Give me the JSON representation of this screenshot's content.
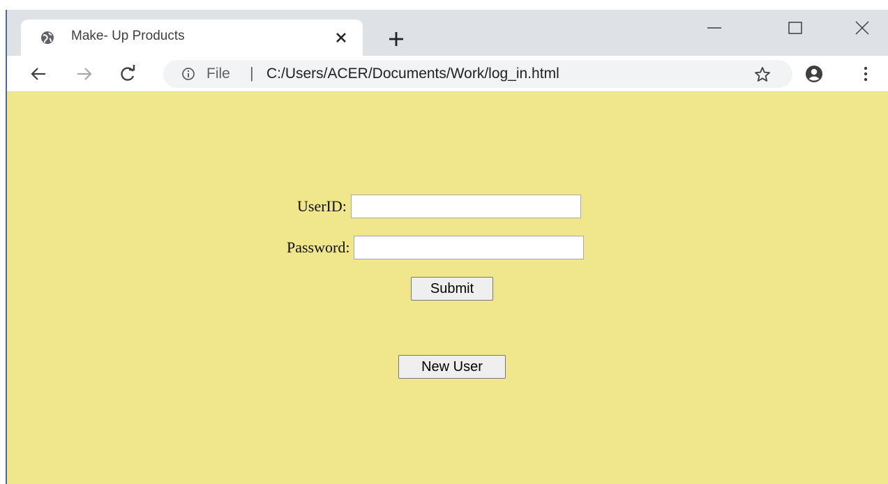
{
  "tab": {
    "title": "Make- Up Products"
  },
  "address_bar": {
    "file_label": "File",
    "separator": "|",
    "url": "C:/Users/ACER/Documents/Work/log_in.html"
  },
  "form": {
    "userid_label": "UserID:",
    "userid_value": "",
    "password_label": "Password:",
    "password_value": "",
    "submit_label": "Submit",
    "new_user_label": "New User"
  },
  "colors": {
    "page_background": "#f0e68c",
    "tabstrip": "#dee1e6",
    "omnibox": "#f1f3f4"
  },
  "icons": [
    "globe-icon",
    "close-icon",
    "plus-icon",
    "minimize-icon",
    "maximize-icon",
    "window-close-icon",
    "back-arrow-icon",
    "forward-arrow-icon",
    "reload-icon",
    "info-icon",
    "star-icon",
    "profile-icon",
    "menu-dots-icon"
  ]
}
